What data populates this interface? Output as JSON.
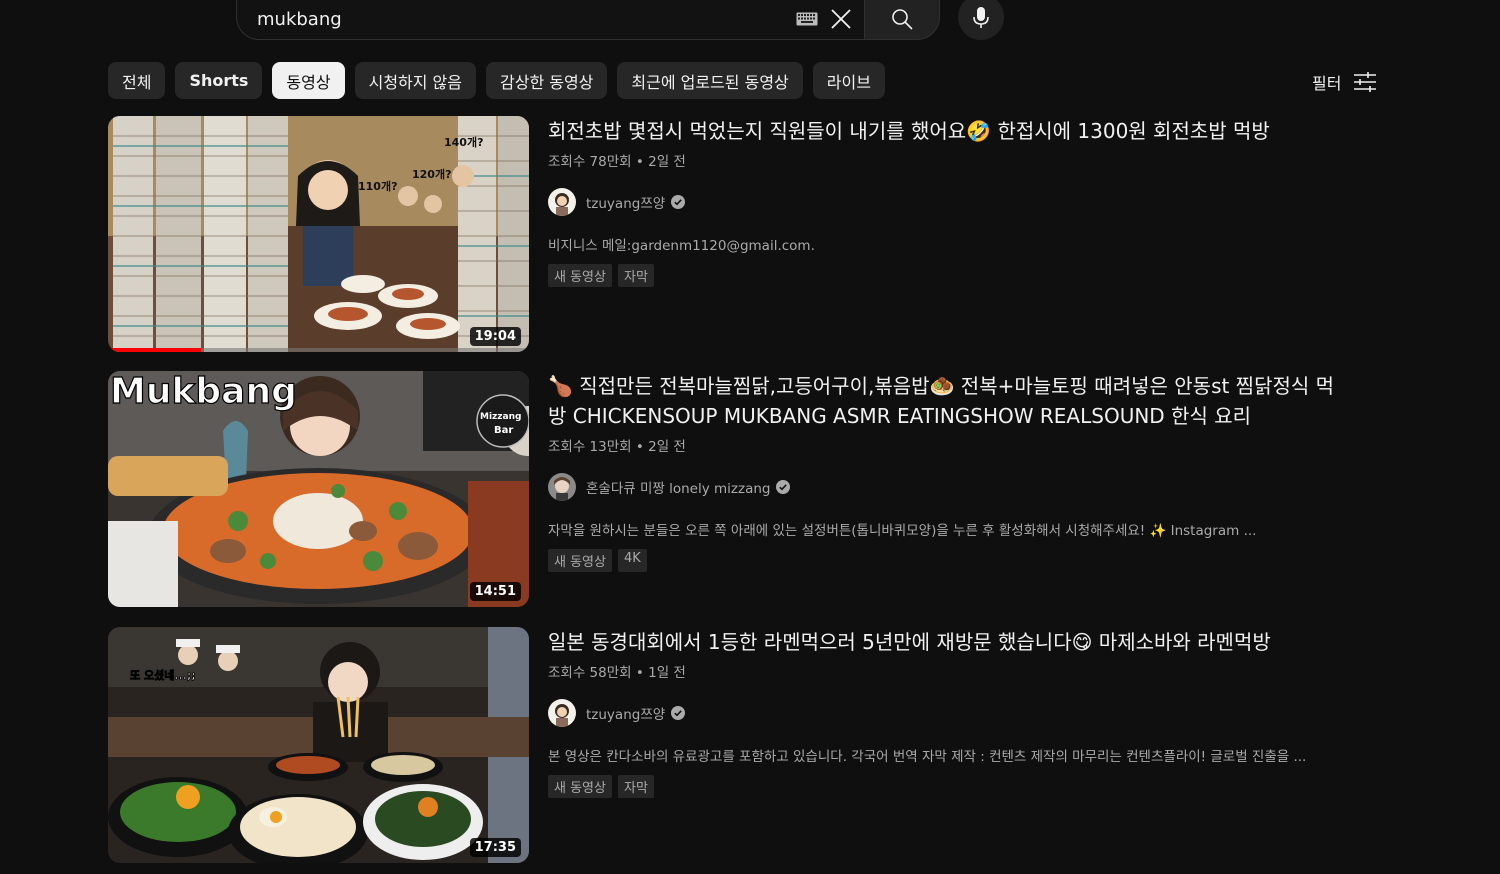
{
  "search": {
    "query": "mukbang",
    "keyboard_icon": "keyboard-icon",
    "clear_icon": "close-icon",
    "search_icon": "search-icon",
    "mic_icon": "microphone-icon"
  },
  "chips": [
    {
      "label": "전체",
      "active": false
    },
    {
      "label": "Shorts",
      "active": false
    },
    {
      "label": "동영상",
      "active": true
    },
    {
      "label": "시청하지 않음",
      "active": false
    },
    {
      "label": "감상한 동영상",
      "active": false
    },
    {
      "label": "최근에 업로드된 동영상",
      "active": false
    },
    {
      "label": "라이브",
      "active": false
    }
  ],
  "filter": {
    "label": "필터",
    "icon": "sliders-icon"
  },
  "results": [
    {
      "title": "회전초밥 몇접시 먹었는지 직원들이 내기를 했어요🤣 한접시에 1300원 회전초밥 먹방",
      "meta": "조회수 78만회 • 2일 전",
      "channel": "tzuyang쯔양",
      "verified": true,
      "description": "비지니스 메일:gardenm1120@gmail.com.",
      "badges": [
        "새 동영상",
        "자막"
      ],
      "duration": "19:04",
      "watch_progress": 0.22,
      "thumb_text": [
        "140개?",
        "120개?",
        "110개?"
      ]
    },
    {
      "title": "🍗 직접만든 전복마늘찜닭,고등어구이,볶음밥🧆 전복+마늘토핑 때려넣은 안동st 찜닭정식 먹방 CHICKENSOUP MUKBANG ASMR EATINGSHOW REALSOUND 한식 요리",
      "meta": "조회수 13만회 • 2일 전",
      "channel": "혼술다큐 미짱 lonely mizzang",
      "verified": true,
      "description": "자막을 원하시는 분들은 오른 쪽 아래에 있는 설정버튼(톱니바퀴모양)을 누른 후 활성화해서 시청해주세요! ✨ Instagram ...",
      "badges": [
        "새 동영상",
        "4K"
      ],
      "duration": "14:51",
      "watch_progress": 0,
      "thumb_text": [
        "Mukbang",
        "Mizzang",
        "Bar"
      ]
    },
    {
      "title": "일본 동경대회에서 1등한 라멘먹으러 5년만에 재방문 했습니다😋 마제소바와 라멘먹방",
      "meta": "조회수 58만회 • 1일 전",
      "channel": "tzuyang쯔양",
      "verified": true,
      "description": "본 영상은 칸다소바의 유료광고를 포함하고 있습니다. 각국어 번역 자막 제작 : 컨텐츠 제작의 마무리는 컨텐츠플라이! 글로벌 진출을 ...",
      "badges": [
        "새 동영상",
        "자막"
      ],
      "duration": "17:35",
      "watch_progress": 0,
      "thumb_text": [
        "또 오셨네...;;"
      ]
    }
  ],
  "colors": {
    "background": "#0f0f0f",
    "chip": "#272727",
    "chip_active": "#f1f1f1",
    "progress": "#ff0000",
    "secondary_text": "#aaaaaa"
  }
}
